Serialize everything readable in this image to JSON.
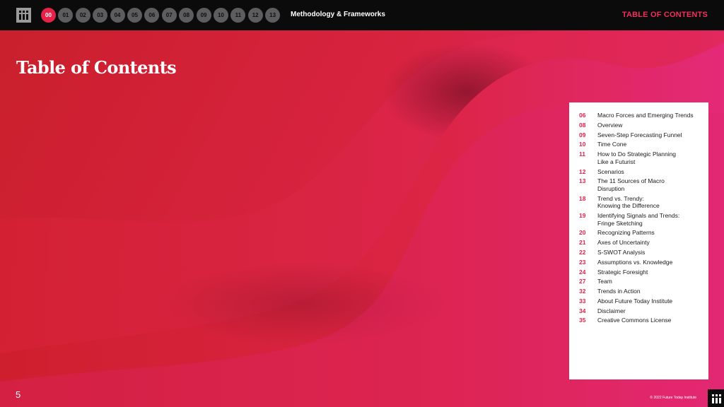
{
  "header": {
    "section_name": "Methodology & Frameworks",
    "toc_link": "TABLE OF CONTENTS",
    "chapters": [
      "00",
      "01",
      "02",
      "03",
      "04",
      "05",
      "06",
      "07",
      "08",
      "09",
      "10",
      "11",
      "12",
      "13"
    ],
    "active_chapter": "00",
    "accent_color": "#e5234a"
  },
  "page": {
    "title": "Table of Contents",
    "page_number": "5",
    "copyright": "© 2022 Future Today Institute"
  },
  "toc": [
    {
      "num": "06",
      "title": "Macro Forces and Emerging Trends"
    },
    {
      "num": "08",
      "title": "Overview"
    },
    {
      "num": "09",
      "title": "Seven-Step Forecasting Funnel"
    },
    {
      "num": "10",
      "title": "Time Cone"
    },
    {
      "num": "11",
      "title": "How to Do Strategic Planning\nLike a Futurist"
    },
    {
      "num": "12",
      "title": "Scenarios"
    },
    {
      "num": "13",
      "title": "The 11 Sources of Macro\nDisruption"
    },
    {
      "num": "18",
      "title": "Trend vs. Trendy:\nKnowing the Difference"
    },
    {
      "num": "19",
      "title": "Identifying Signals and Trends:\nFringe Sketching"
    },
    {
      "num": "20",
      "title": "Recognizing Patterns"
    },
    {
      "num": "21",
      "title": "Axes of Uncertainty"
    },
    {
      "num": "22",
      "title": "S-SWOT Analysis"
    },
    {
      "num": "23",
      "title": "Assumptions vs. Knowledge"
    },
    {
      "num": "24",
      "title": "Strategic Foresight"
    },
    {
      "num": "27",
      "title": "Team"
    },
    {
      "num": "32",
      "title": "Trends in Action"
    },
    {
      "num": "33",
      "title": "About Future Today Institute"
    },
    {
      "num": "34",
      "title": "Disclaimer"
    },
    {
      "num": "35",
      "title": "Creative Commons License"
    }
  ]
}
